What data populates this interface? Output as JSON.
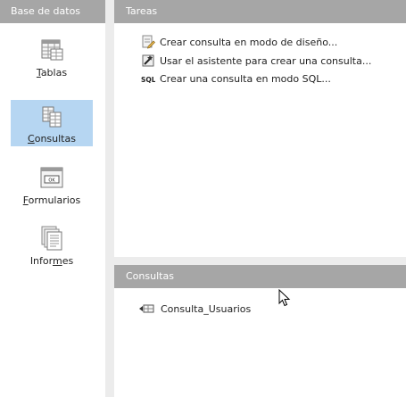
{
  "left": {
    "header": "Base de datos",
    "items": [
      {
        "id": "tablas",
        "pre": "",
        "acc": "T",
        "post": "ablas",
        "icon": "table-icon",
        "selected": false
      },
      {
        "id": "consultas",
        "pre": "",
        "acc": "C",
        "post": "onsultas",
        "icon": "query-icon",
        "selected": true
      },
      {
        "id": "formularios",
        "pre": "",
        "acc": "F",
        "post": "ormularios",
        "icon": "form-icon",
        "selected": false
      },
      {
        "id": "informes",
        "pre": "Infor",
        "acc": "m",
        "post": "es",
        "icon": "report-icon",
        "selected": false
      }
    ]
  },
  "tasks": {
    "header": "Tareas",
    "items": [
      {
        "label": "Crear consulta en modo de diseño...",
        "icon": "design-view-icon"
      },
      {
        "label": "Usar el asistente para crear una consulta...",
        "icon": "wizard-icon"
      },
      {
        "label": "Crear una consulta en modo SQL...",
        "icon": "sql-icon"
      }
    ]
  },
  "queries": {
    "header": "Consultas",
    "items": [
      {
        "label": "Consulta_Usuarios",
        "icon": "query-item-icon"
      }
    ]
  },
  "colors": {
    "header_bg": "#a6a6a6",
    "selected_bg": "#b6d6f2",
    "panel_bg": "#ffffff",
    "gap_bg": "#ececec"
  }
}
